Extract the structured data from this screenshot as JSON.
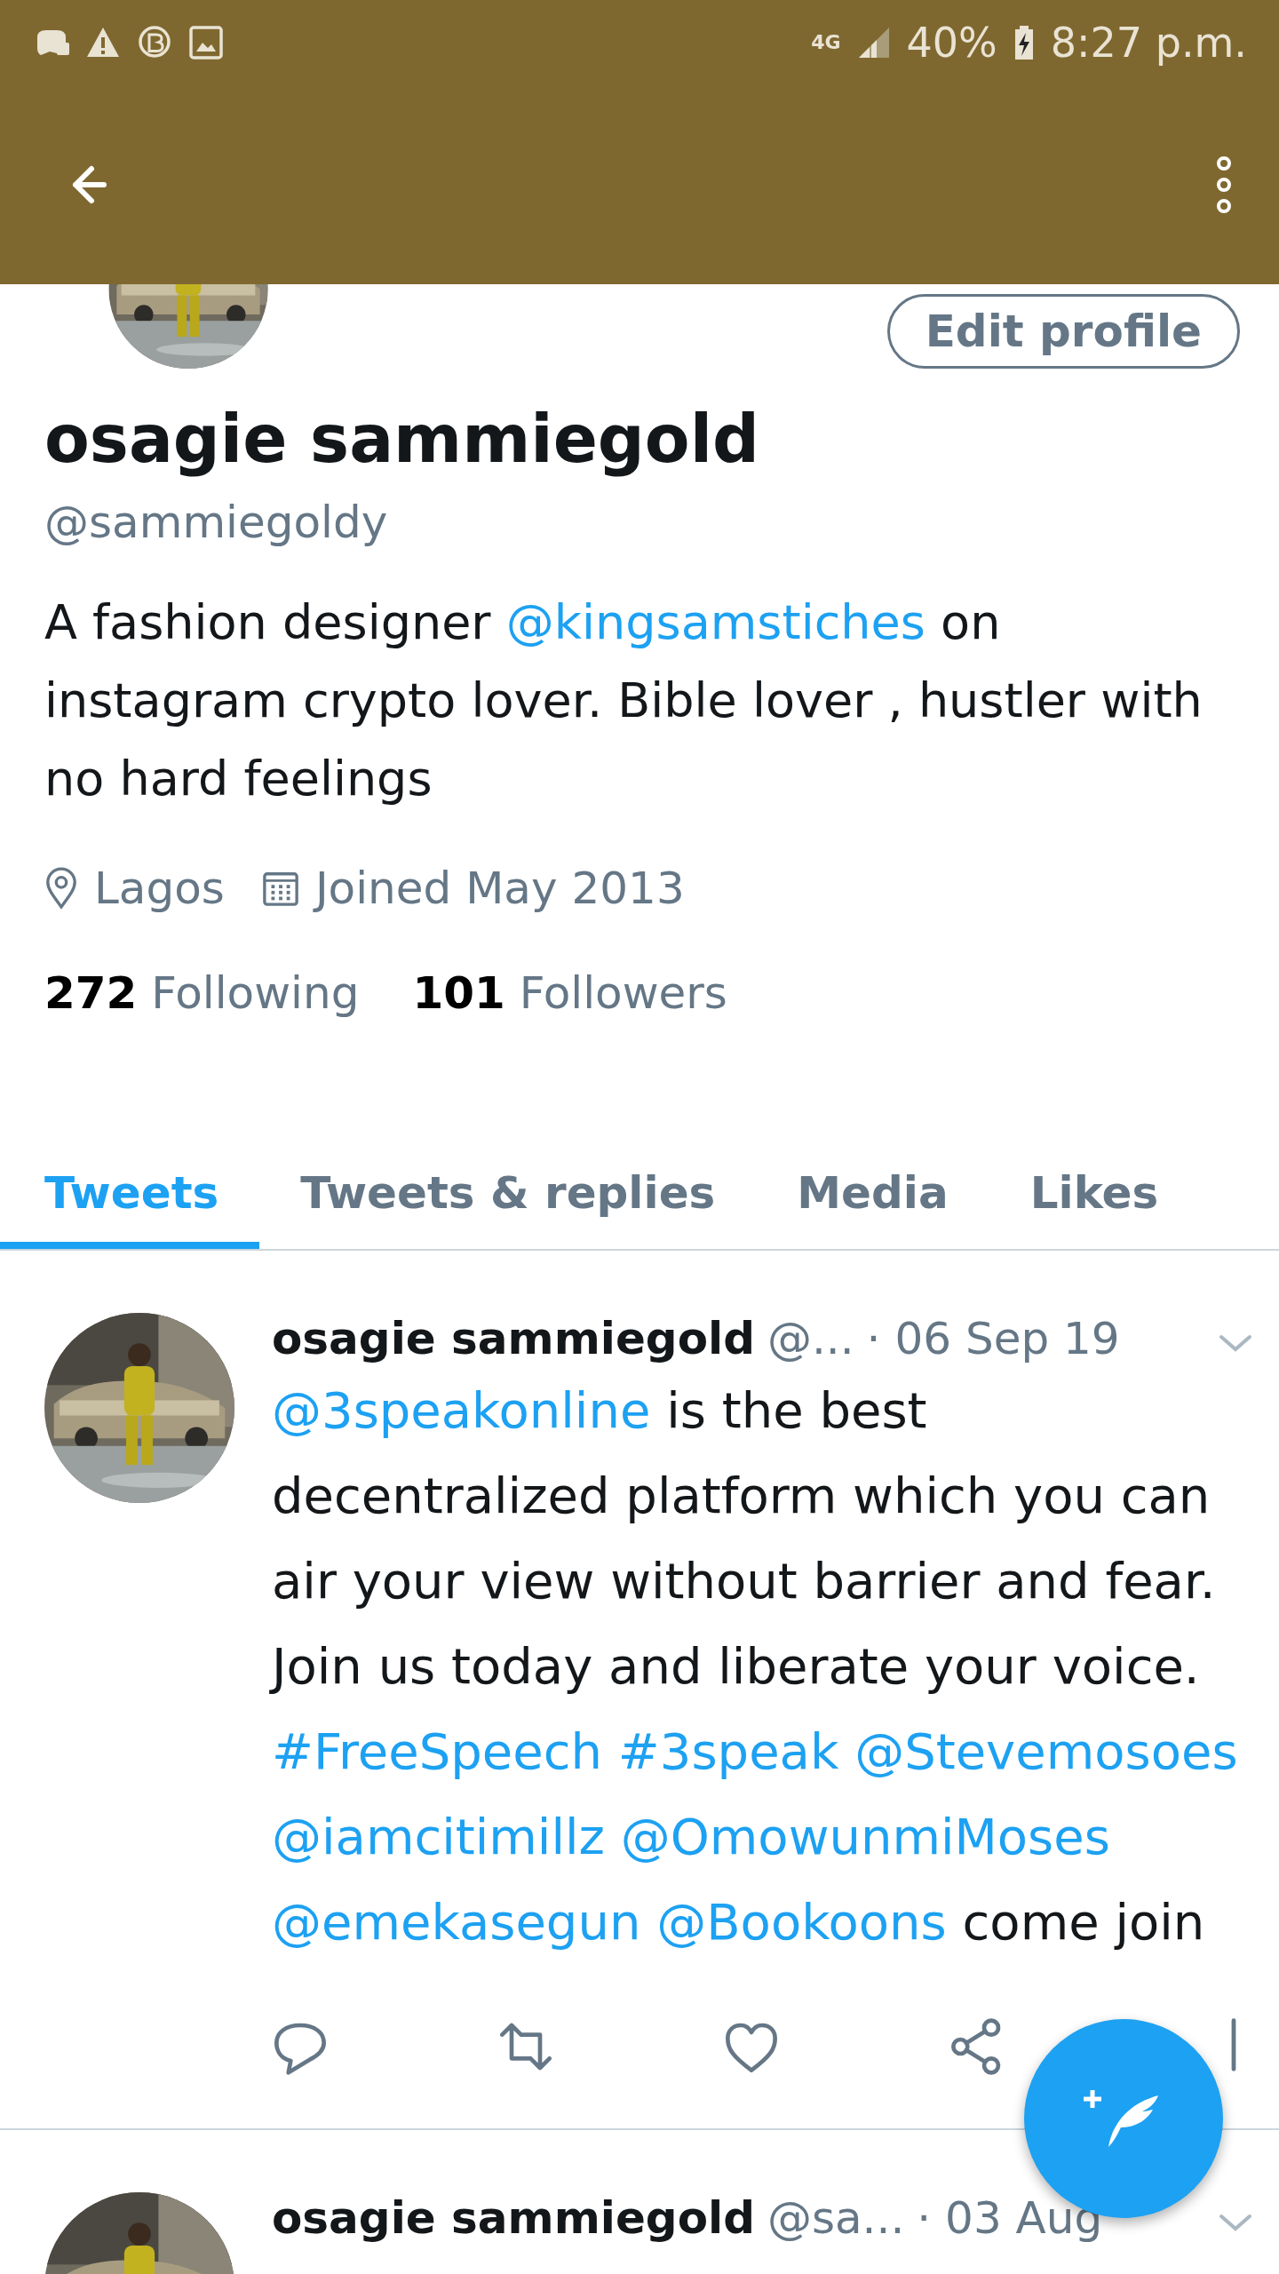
{
  "status_bar": {
    "network": "4G",
    "battery": "40%",
    "time": "8:27 p.m."
  },
  "profile": {
    "edit_button": "Edit profile",
    "name": "osagie sammiegold",
    "handle": "@sammiegoldy",
    "bio": [
      {
        "kind": "text",
        "text": "A fashion designer "
      },
      {
        "kind": "link",
        "text": "@kingsamstiches"
      },
      {
        "kind": "text",
        "text": " on instagram crypto lover. Bible lover , hustler with no hard feelings"
      }
    ],
    "location": "Lagos",
    "joined": "Joined May 2013",
    "following_count": "272",
    "following_label": "Following",
    "followers_count": "101",
    "followers_label": "Followers"
  },
  "tabs": [
    {
      "label": "Tweets",
      "selected": true
    },
    {
      "label": "Tweets & replies",
      "selected": false
    },
    {
      "label": "Media",
      "selected": false
    },
    {
      "label": "Likes",
      "selected": false
    }
  ],
  "tweets": [
    {
      "name": "osagie sammiegold",
      "handle": "@...",
      "date": "· 06 Sep 19",
      "body": [
        {
          "kind": "link",
          "text": "@3speakonline"
        },
        {
          "kind": "text",
          "text": " is the best decentralized platform which you can air your view without barrier and fear. Join us today and liberate your voice.\n"
        },
        {
          "kind": "link",
          "text": "#FreeSpeech"
        },
        {
          "kind": "link",
          "text": "#3speak"
        },
        {
          "kind": "link",
          "text": "@Stevemosoes"
        },
        {
          "kind": "link",
          "text": "@iamcitimillz"
        },
        {
          "kind": "link",
          "text": "@OmowunmiMoses"
        },
        {
          "kind": "link",
          "text": "@emekasegun"
        },
        {
          "kind": "link",
          "text": "@Bookoons"
        },
        {
          "kind": "text",
          "text": " come join"
        }
      ]
    },
    {
      "name": "osagie sammiegold",
      "handle": "@sa...",
      "date": "· 03 Aug"
    }
  ]
}
